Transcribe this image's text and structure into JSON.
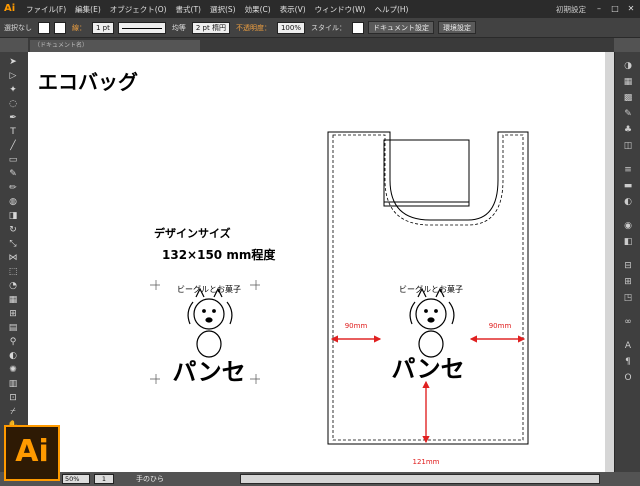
{
  "app": {
    "logo": "Ai"
  },
  "menubar": {
    "items": [
      "ファイル(F)",
      "編集(E)",
      "オブジェクト(O)",
      "書式(T)",
      "選択(S)",
      "効果(C)",
      "表示(V)",
      "ウィンドウ(W)",
      "ヘルプ(H)"
    ],
    "workspace": "初期設定"
  },
  "controlbar": {
    "selection": "選択なし",
    "stroke_label": "線：",
    "stroke_width": "1 pt",
    "line_style": "均等",
    "brush": "2 pt 楕円",
    "opacity_label": "不透明度：",
    "opacity_value": "100%",
    "style_label": "スタイル：",
    "doc_settings": "ドキュメント設定",
    "preferences": "環境設定"
  },
  "document": {
    "tab_label": "（ドキュメント名）"
  },
  "artboard": {
    "title": "エコバッグ",
    "spec_line1": "デザインサイズ",
    "spec_line2": "132×150 mm程度",
    "logo_arc_text_left": "ビーグルとお菓子",
    "logo_main_text_left": "パンセ",
    "logo_arc_text_right": "ビーグルとお菓子",
    "logo_main_text_right": "パンセ",
    "dim_left": "90mm",
    "dim_right": "90mm",
    "dim_bottom": "121mm"
  },
  "statusbar": {
    "zoom": "50%",
    "page": "1",
    "tool": "手のひら"
  },
  "colors": {
    "accent": "#ff9a00",
    "dimension": "#e02020"
  },
  "icons": {
    "toolbar": [
      "selection-tool-icon",
      "direct-selection-tool-icon",
      "magic-wand-icon",
      "lasso-icon",
      "pen-tool-icon",
      "type-tool-icon",
      "line-tool-icon",
      "rectangle-tool-icon",
      "paintbrush-icon",
      "pencil-icon",
      "blob-brush-icon",
      "eraser-icon",
      "rotate-icon",
      "scale-icon",
      "width-tool-icon",
      "free-transform-icon",
      "shape-builder-icon",
      "perspective-grid-icon",
      "mesh-icon",
      "gradient-icon",
      "eyedropper-icon",
      "blend-icon",
      "symbol-sprayer-icon",
      "column-graph-icon",
      "artboard-icon",
      "slice-icon",
      "hand-icon",
      "zoom-icon"
    ],
    "right_panel": [
      "color-icon",
      "color-guide-icon",
      "swatches-icon",
      "brushes-icon",
      "symbols-icon",
      "graphic-styles-icon",
      "stroke-icon",
      "gradient-panel-icon",
      "transparency-icon",
      "appearance-icon",
      "layers-icon",
      "align-icon",
      "transform-icon",
      "pathfinder-icon",
      "links-icon",
      "character-icon",
      "paragraph-icon",
      "opentype-icon"
    ]
  }
}
